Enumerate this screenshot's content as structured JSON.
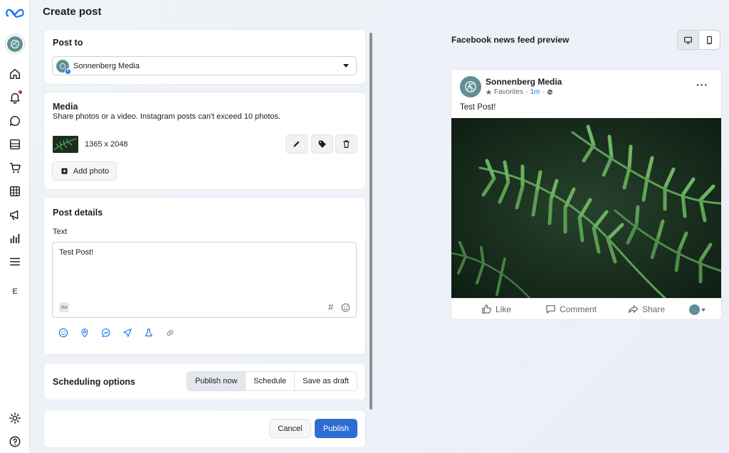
{
  "app": {
    "title": "Create post",
    "side_letter": "E",
    "colors": {
      "accent": "#2d6ed3",
      "facebook_blue": "#1877f2",
      "avatar": "#5f8f94",
      "notification": "#e41e3f"
    }
  },
  "sidebar": {
    "items": [
      {
        "name": "home-icon"
      },
      {
        "name": "bell-icon"
      },
      {
        "name": "chat-icon"
      },
      {
        "name": "content-icon"
      },
      {
        "name": "cart-icon"
      },
      {
        "name": "table-icon"
      },
      {
        "name": "megaphone-icon"
      },
      {
        "name": "chart-icon"
      },
      {
        "name": "menu-icon"
      }
    ]
  },
  "post_to": {
    "title": "Post to",
    "selected": "Sonnenberg Media"
  },
  "media": {
    "title": "Media",
    "subtitle": "Share photos or a video. Instagram posts can't exceed 10 photos.",
    "dimensions": "1365 x 2048",
    "add_photo": "Add photo"
  },
  "post_details": {
    "title": "Post details",
    "text_label": "Text",
    "text_value": "Test Post!"
  },
  "scheduling": {
    "title": "Scheduling options",
    "options": [
      "Publish now",
      "Schedule",
      "Save as draft"
    ],
    "selected": "Publish now"
  },
  "footer": {
    "cancel": "Cancel",
    "publish": "Publish"
  },
  "preview": {
    "title": "Facebook news feed preview",
    "page_name": "Sonnenberg Media",
    "favorites": "Favorites",
    "dot": "·",
    "time": "1m",
    "dot2": "·",
    "text": "Test Post!",
    "more": "···",
    "actions": {
      "like": "Like",
      "comment": "Comment",
      "share": "Share"
    }
  }
}
